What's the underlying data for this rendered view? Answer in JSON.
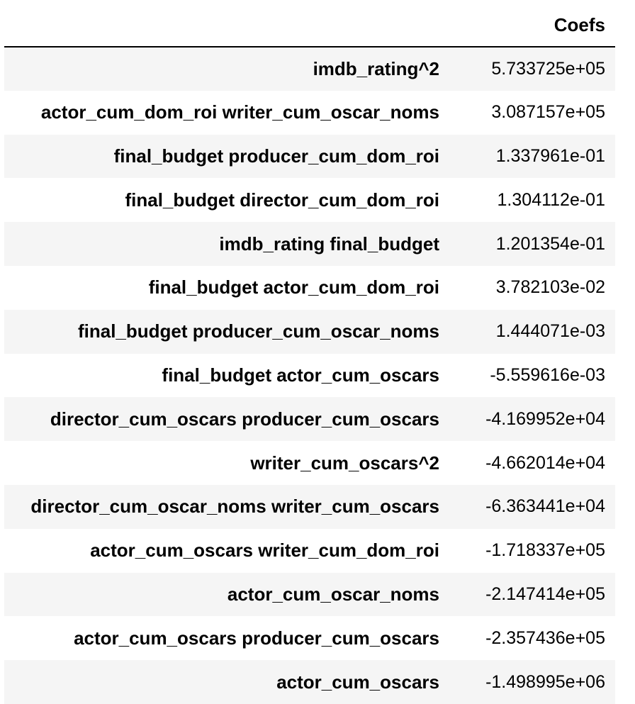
{
  "table": {
    "column_header": "Coefs",
    "rows": [
      {
        "feature": "imdb_rating^2",
        "coef": "5.733725e+05"
      },
      {
        "feature": "actor_cum_dom_roi writer_cum_oscar_noms",
        "coef": "3.087157e+05"
      },
      {
        "feature": "final_budget producer_cum_dom_roi",
        "coef": "1.337961e-01"
      },
      {
        "feature": "final_budget director_cum_dom_roi",
        "coef": "1.304112e-01"
      },
      {
        "feature": "imdb_rating final_budget",
        "coef": "1.201354e-01"
      },
      {
        "feature": "final_budget actor_cum_dom_roi",
        "coef": "3.782103e-02"
      },
      {
        "feature": "final_budget producer_cum_oscar_noms",
        "coef": "1.444071e-03"
      },
      {
        "feature": "final_budget actor_cum_oscars",
        "coef": "-5.559616e-03"
      },
      {
        "feature": "director_cum_oscars producer_cum_oscars",
        "coef": "-4.169952e+04"
      },
      {
        "feature": "writer_cum_oscars^2",
        "coef": "-4.662014e+04"
      },
      {
        "feature": "director_cum_oscar_noms writer_cum_oscars",
        "coef": "-6.363441e+04"
      },
      {
        "feature": "actor_cum_oscars writer_cum_dom_roi",
        "coef": "-1.718337e+05"
      },
      {
        "feature": "actor_cum_oscar_noms",
        "coef": "-2.147414e+05"
      },
      {
        "feature": "actor_cum_oscars producer_cum_oscars",
        "coef": "-2.357436e+05"
      },
      {
        "feature": "actor_cum_oscars",
        "coef": "-1.498995e+06"
      }
    ]
  }
}
